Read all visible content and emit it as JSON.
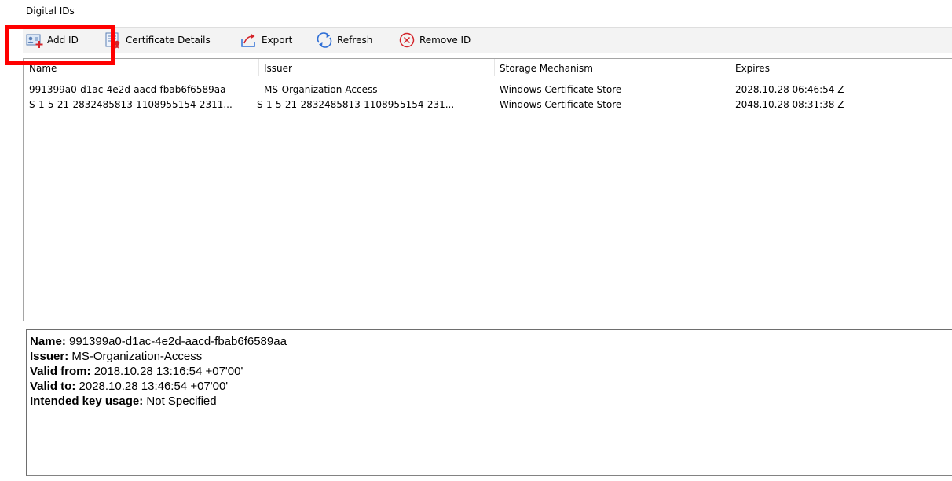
{
  "window": {
    "title": "Digital IDs"
  },
  "toolbar": {
    "add_id": {
      "label": "Add ID",
      "icon": "add-id-icon"
    },
    "certificate_details": {
      "label": "Certificate Details",
      "icon": "certificate-details-icon"
    },
    "export": {
      "label": "Export",
      "icon": "export-icon"
    },
    "refresh": {
      "label": "Refresh",
      "icon": "refresh-icon"
    },
    "remove_id": {
      "label": "Remove ID",
      "icon": "remove-id-icon"
    }
  },
  "list": {
    "columns": [
      "Name",
      "Issuer",
      "Storage Mechanism",
      "Expires"
    ],
    "rows": [
      [
        "991399a0-d1ac-4e2d-aacd-fbab6f6589aa",
        "MS-Organization-Access",
        "Windows Certificate Store",
        "2028.10.28 06:46:54 Z"
      ],
      [
        "S-1-5-21-2832485813-1108955154-2311...",
        "S-1-5-21-2832485813-1108955154-231...",
        "Windows Certificate Store",
        "2048.10.28 08:31:38 Z"
      ]
    ]
  },
  "details": {
    "name_label": "Name:",
    "name_value": "991399a0-d1ac-4e2d-aacd-fbab6f6589aa",
    "issuer_label": "Issuer:",
    "issuer_value": "MS-Organization-Access",
    "valid_from_label": "Valid from:",
    "valid_from_value": "2018.10.28 13:16:54 +07'00'",
    "valid_to_label": "Valid to:",
    "valid_to_value": "2028.10.28 13:46:54 +07'00'",
    "key_usage_label": "Intended key usage:",
    "key_usage_value": "Not Specified"
  },
  "colors": {
    "highlight": "#ff0000",
    "toolbar_bg": "#f3f3f3",
    "icon_blue": "#2f6fd6",
    "icon_red": "#d4242a"
  }
}
